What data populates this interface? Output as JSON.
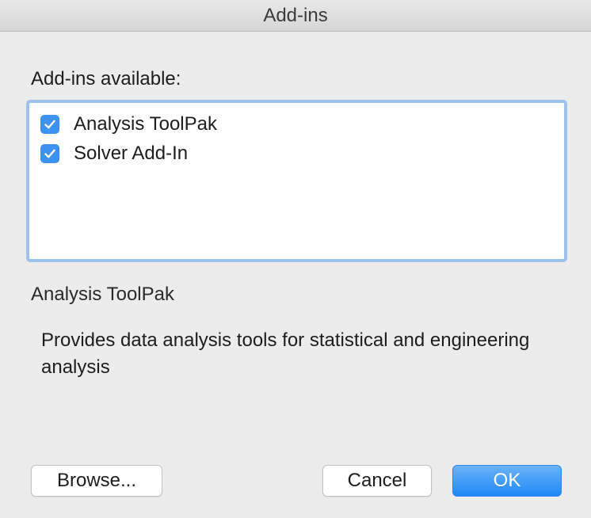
{
  "window": {
    "title": "Add-ins"
  },
  "addins": {
    "label": "Add-ins available:",
    "items": [
      {
        "label": "Analysis ToolPak",
        "checked": true
      },
      {
        "label": "Solver Add-In",
        "checked": true
      }
    ]
  },
  "details": {
    "title": "Analysis ToolPak",
    "description": "Provides data analysis tools for statistical and engineering analysis"
  },
  "buttons": {
    "browse": "Browse...",
    "cancel": "Cancel",
    "ok": "OK"
  },
  "colors": {
    "accent": "#3b92f3",
    "list_focus_ring": "#9cc3ee",
    "window_bg": "#ececec"
  }
}
